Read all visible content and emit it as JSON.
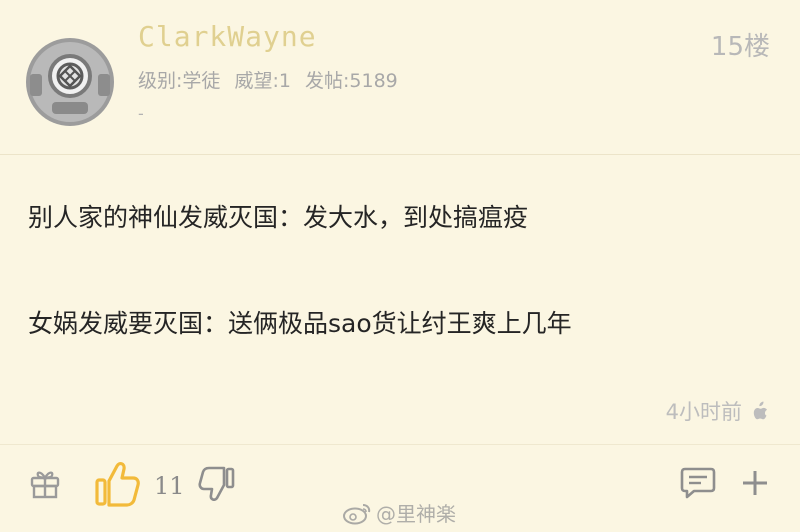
{
  "post": {
    "username": "ClarkWayne",
    "level_label": "级别:",
    "level": "学徒",
    "reputation_label": "威望:",
    "reputation": "1",
    "posts_label": "发帖:",
    "posts": "5189",
    "signature": "-",
    "floor": "15楼",
    "content": [
      "别人家的神仙发威灭国：发大水，到处搞瘟疫",
      "女娲发威要灭国：送俩极品sao货让纣王爽上几年"
    ],
    "time": "4小时前"
  },
  "actions": {
    "like_count": "11"
  },
  "watermark": {
    "text": "@里神楽"
  },
  "colors": {
    "background": "#fbf6e2",
    "username": "#e0d090",
    "like_accent": "#f2ba3a"
  }
}
